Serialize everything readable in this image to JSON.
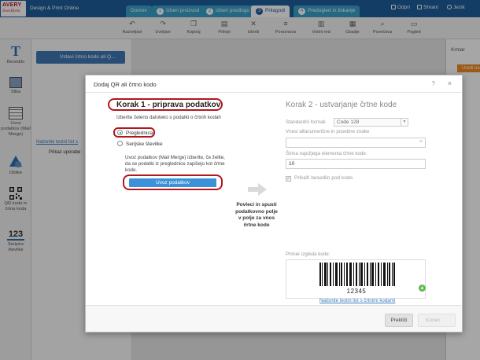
{
  "app": {
    "logo_line1": "AVERY",
    "logo_line2": "Zweckform",
    "title": "Design & Print Online"
  },
  "tabs": [
    {
      "num": "",
      "label": "Domov"
    },
    {
      "num": "1",
      "label": "Izberi proizvod"
    },
    {
      "num": "2",
      "label": "Izberi predlogo"
    },
    {
      "num": "3",
      "label": "Prilagodi"
    },
    {
      "num": "4",
      "label": "Predogled in tiskanje"
    }
  ],
  "top_actions": {
    "open": "Odpri",
    "save": "Shrani",
    "language": "Jezik"
  },
  "toolbar": [
    {
      "icon": "undo-icon",
      "glyph": "↶",
      "label": "Razveljavi"
    },
    {
      "icon": "redo-icon",
      "glyph": "↷",
      "label": "Uveljavi"
    },
    {
      "icon": "copy-icon",
      "glyph": "❐",
      "label": "Kopiraj"
    },
    {
      "icon": "paste-icon",
      "glyph": "▤",
      "label": "Prilepi"
    },
    {
      "icon": "delete-icon",
      "glyph": "✕",
      "label": "Izbriši"
    },
    {
      "icon": "align-icon",
      "glyph": "≡",
      "label": "Poravnava"
    },
    {
      "icon": "order-icon",
      "glyph": "▥",
      "label": "Vrstni red"
    },
    {
      "icon": "grid-icon",
      "glyph": "▦",
      "label": "Ozadje"
    },
    {
      "icon": "zoom-icon",
      "glyph": "⌕",
      "label": "Povečava"
    },
    {
      "icon": "view-icon",
      "glyph": "▭",
      "label": "Pogled"
    }
  ],
  "sidebar": [
    {
      "icon": "text-icon",
      "label1": "Besedilo",
      "label2": ""
    },
    {
      "icon": "image-icon",
      "label1": "Slika",
      "label2": ""
    },
    {
      "icon": "mail-merge-icon",
      "label1": "Uvoz",
      "label2": "podatkov (Mail Merge)"
    },
    {
      "icon": "shapes-icon",
      "label1": "Oblike",
      "label2": ""
    },
    {
      "icon": "qr-code-icon",
      "label1": "QR koda in",
      "label2": "črtna koda"
    },
    {
      "icon": "numbers-icon",
      "label1": "Serijske",
      "label2": "številke"
    }
  ],
  "panel": {
    "button": "Vstavi črtno kodo ali Q...",
    "link_fragment": "Natisnite testni list s",
    "preview_fragment": "Prikaz uporabe",
    "right_label": "Krmar",
    "right_button": "Uredi ose"
  },
  "dialog": {
    "title": "Dodaj QR ali črtno kodo",
    "help": "?",
    "close": "×",
    "step1": {
      "title": "Korak 1 - priprava podatkov",
      "intro": "Izberite želeno datoteko s podatki o črtnih kodah",
      "option_spreadsheet": "Preglednica",
      "option_serial": "Serijske številke",
      "description": "Uvoz podatkov (Mail Merge) izberite, če želite, da se podatki iz preglednice zapišejo kot črtne kode.",
      "upload_button": "Uvoz podatkov"
    },
    "drag_text": "Povleci in spusti podatkovno polje v polje za vnos črtne kode",
    "step2": {
      "title": "Korak 2 - ustvarjanje črtne kode",
      "formats_label": "Standardni formati",
      "format_value": "Code 128",
      "input_label": "Vnesi alfanumerične in posebne znake",
      "input_value": "",
      "width_label": "Širina najožjega elementa črtne kode:",
      "width_value": "10",
      "show_text_label": "Prikaži besedilo pod kodo",
      "preview_label": "Primer izgleda kode:",
      "barcode_number": "12345",
      "test_link": "Natisnite testni list s črtnimi kodami"
    },
    "buttons": {
      "cancel": "Prekliči",
      "done": "Konec"
    }
  },
  "colors": {
    "brand_blue": "#1f5f9c",
    "tab_blue": "#3aa0c9",
    "highlight_red": "#b3161d",
    "button_blue": "#3b92d8"
  }
}
